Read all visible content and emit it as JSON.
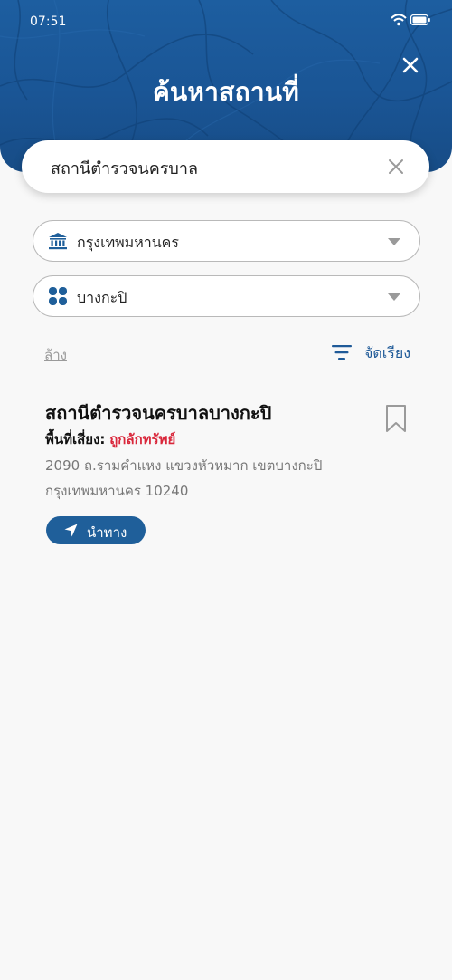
{
  "status_bar": {
    "time": "07:51",
    "wifi_icon": "wifi-icon",
    "battery_icon": "battery-icon"
  },
  "header": {
    "title": "ค้นหาสถานที่",
    "close_icon": "close-icon"
  },
  "search": {
    "value": "สถานีตำรวจนครบาล",
    "placeholder": "",
    "clear_icon": "clear-icon"
  },
  "filters": {
    "province": {
      "icon": "government-building-icon",
      "label": "กรุงเทพมหานคร"
    },
    "district": {
      "icon": "district-grid-icon",
      "label": "บางกะปิ"
    }
  },
  "actions": {
    "clear_label": "ล้าง",
    "sort_label": "จัดเรียง",
    "sort_icon": "sort-icon"
  },
  "results": [
    {
      "title": "สถานีตำรวจนครบาลบางกะปิ",
      "risk_label": "พื้นที่เสี่ยง:",
      "risk_value": "ถูกลักทรัพย์",
      "address_line1": "2090 ถ.รามคำแหง แขวงหัวหมาก เขตบางกะปิ",
      "address_line2": "กรุงเทพมหานคร 10240",
      "navigate_label": "นำทาง",
      "bookmark_icon": "bookmark-icon",
      "navigate_icon": "navigation-arrow-icon"
    }
  ],
  "colors": {
    "header_blue": "#1a5595",
    "accent_blue": "#1f5f9a",
    "risk_red": "#d9263a",
    "background": "#f8f8f8"
  }
}
